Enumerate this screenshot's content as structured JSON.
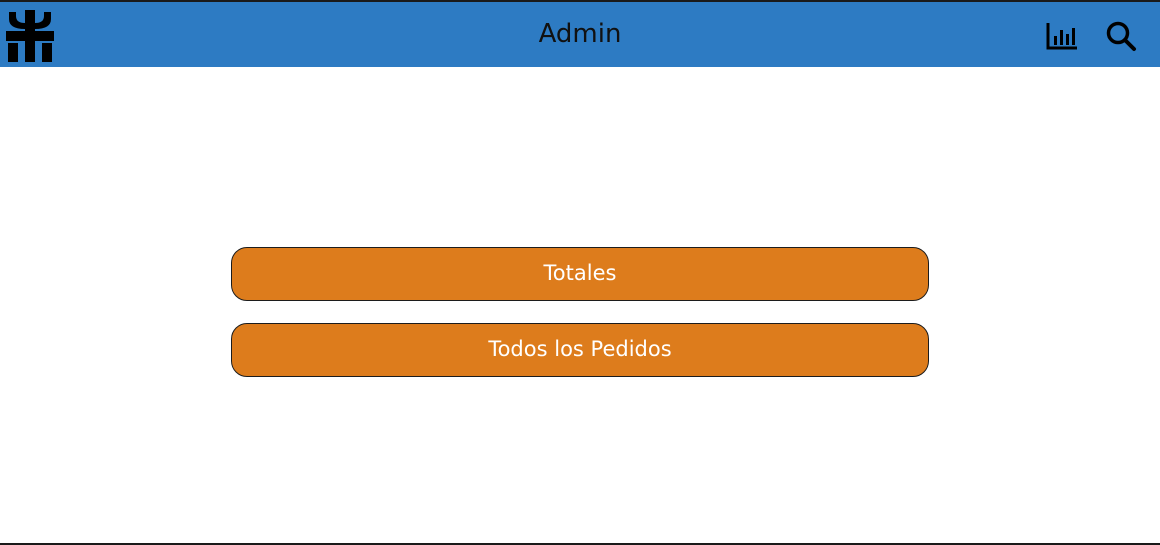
{
  "header": {
    "title": "Admin",
    "background": "#2d7bc3",
    "logo_icon": "utn-logo-icon",
    "actions": [
      {
        "icon": "bar-chart-icon"
      },
      {
        "icon": "search-icon"
      }
    ]
  },
  "menu": {
    "button_color": "#dd7c1c",
    "items": [
      {
        "label": "Totales"
      },
      {
        "label": "Todos los Pedidos"
      }
    ]
  }
}
